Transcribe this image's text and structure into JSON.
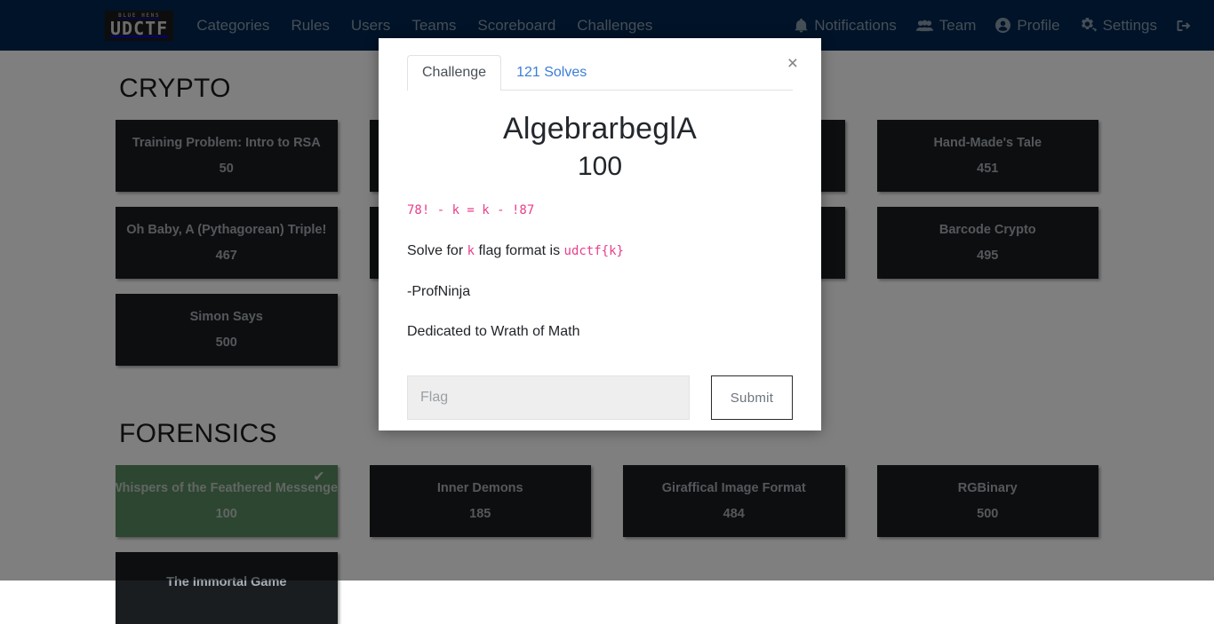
{
  "navbar": {
    "brand": {
      "top_text": "BLUE HENS",
      "main_text": "UDCTF"
    },
    "left_links": [
      {
        "label": "Categories",
        "name": "nav-categories"
      },
      {
        "label": "Rules",
        "name": "nav-rules"
      },
      {
        "label": "Users",
        "name": "nav-users"
      },
      {
        "label": "Teams",
        "name": "nav-teams"
      },
      {
        "label": "Scoreboard",
        "name": "nav-scoreboard"
      },
      {
        "label": "Challenges",
        "name": "nav-challenges"
      }
    ],
    "right_links": [
      {
        "label": "Notifications",
        "icon": "bell-icon"
      },
      {
        "label": "Team",
        "icon": "users-icon"
      },
      {
        "label": "Profile",
        "icon": "user-circle-icon"
      },
      {
        "label": "Settings",
        "icon": "gears-icon"
      },
      {
        "label": "",
        "icon": "sign-out-icon"
      }
    ],
    "background_color": "#002751",
    "link_color": "#8c9cad"
  },
  "board": {
    "categories": [
      {
        "title": "CRYPTO",
        "columns": [
          [
            {
              "name": "Training Problem: Intro to RSA",
              "value": "50",
              "solved": false
            },
            {
              "name": "Oh Baby, A (Pythagorean) Triple!",
              "value": "467",
              "solved": false
            },
            {
              "name": "Simon Says",
              "value": "500",
              "solved": false
            }
          ],
          [
            {
              "name": "AlgebrarbeglA",
              "value": "100",
              "solved": false
            },
            {
              "name": "",
              "value": "",
              "solved": false
            }
          ],
          [
            {
              "name": "",
              "value": "",
              "solved": false
            },
            {
              "name": "",
              "value": "",
              "solved": false
            }
          ],
          [
            {
              "name": "Hand-Made's Tale",
              "value": "451",
              "solved": false
            },
            {
              "name": "Barcode Crypto",
              "value": "495",
              "solved": false
            }
          ]
        ]
      },
      {
        "title": "FORENSICS",
        "columns": [
          [
            {
              "name": "Whispers of the Feathered Messenger",
              "value": "100",
              "solved": true
            },
            {
              "name": "The Immortal Game",
              "value": "",
              "solved": false
            }
          ],
          [
            {
              "name": "Inner Demons",
              "value": "185",
              "solved": false
            }
          ],
          [
            {
              "name": "Giraffical Image Format",
              "value": "484",
              "solved": false
            }
          ],
          [
            {
              "name": "RGBinary",
              "value": "500",
              "solved": false
            }
          ]
        ]
      }
    ],
    "solved_color": "#5a8c63",
    "card_color": "#1a1d20",
    "check_glyph": "✔"
  },
  "modal": {
    "close_glyph": "×",
    "tabs": [
      {
        "label": "Challenge",
        "active": true
      },
      {
        "label": "121 Solves",
        "active": false
      }
    ],
    "title": "AlgebrarbeglA",
    "points": "100",
    "description": {
      "equation": "78! - k = k - !87",
      "line2_before": "Solve for ",
      "line2_code1": "k",
      "line2_middle": " flag format is ",
      "line2_code2": "udctf{k}",
      "line3": "-ProfNinja",
      "line4": "Dedicated to Wrath of Math"
    },
    "flag_placeholder": "Flag",
    "flag_value": "",
    "submit_label": "Submit",
    "accent_code_color": "#e83e8c",
    "link_color": "#3b7dd8"
  }
}
